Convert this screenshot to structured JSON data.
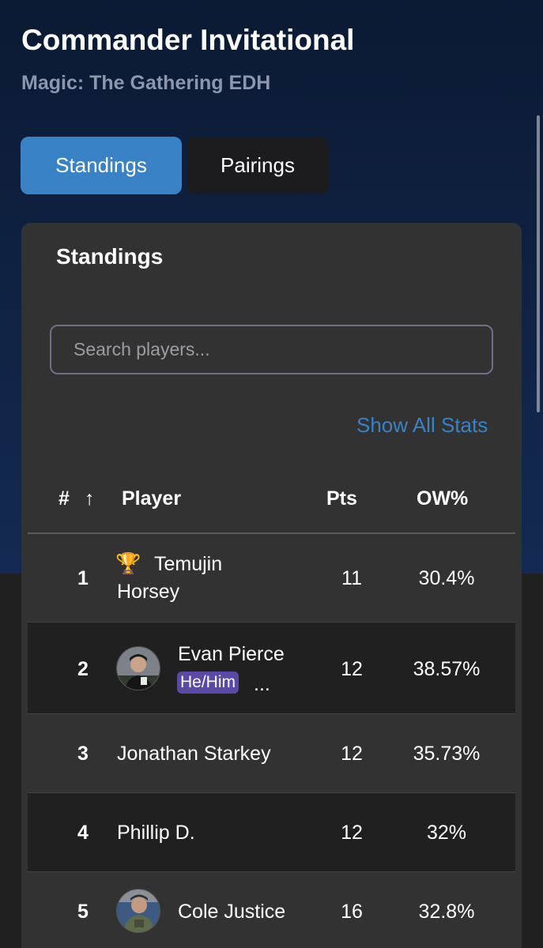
{
  "header": {
    "title": "Commander Invitational",
    "subtitle": "Magic: The Gathering EDH"
  },
  "tabs": [
    {
      "label": "Standings",
      "active": true
    },
    {
      "label": "Pairings",
      "active": false
    }
  ],
  "standings": {
    "title": "Standings",
    "search_placeholder": "Search players...",
    "show_all_label": "Show All Stats",
    "columns": {
      "rank": "#",
      "sort_arrow": "↑",
      "player": "Player",
      "points": "Pts",
      "ow": "OW%"
    },
    "rows": [
      {
        "rank": "1",
        "name_line1": "Temujin",
        "name_line2": "Horsey",
        "points": "11",
        "ow": "30.4%",
        "icon": "trophy-icon"
      },
      {
        "rank": "2",
        "name": "Evan Pierce",
        "pronouns": "He/Him",
        "more": "...",
        "points": "12",
        "ow": "38.57%",
        "avatar": true
      },
      {
        "rank": "3",
        "name": "Jonathan Starkey",
        "points": "12",
        "ow": "35.73%"
      },
      {
        "rank": "4",
        "name": "Phillip D.",
        "points": "12",
        "ow": "32%"
      },
      {
        "rank": "5",
        "name": "Cole Justice",
        "points": "16",
        "ow": "32.8%",
        "avatar": true
      }
    ]
  },
  "colors": {
    "accent": "#3a82c6",
    "badge": "#5a4aa6",
    "card": "#323232"
  }
}
